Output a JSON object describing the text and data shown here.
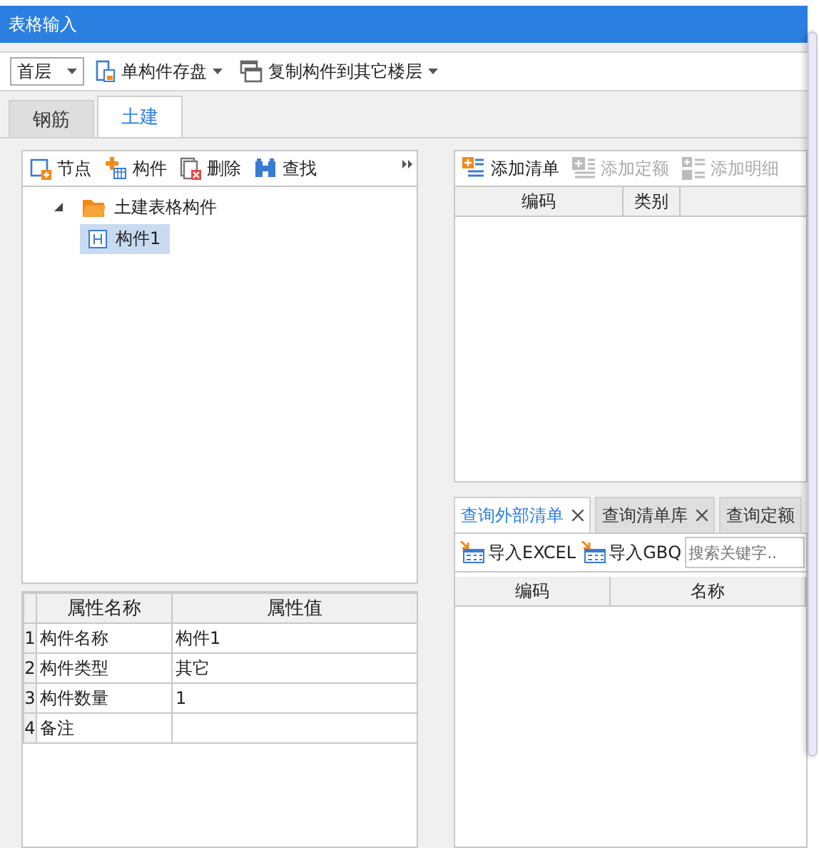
{
  "window": {
    "title": "表格输入"
  },
  "toolbar": {
    "floor_select": {
      "value": "首层"
    },
    "buttons": [
      {
        "label": "单构件存盘"
      },
      {
        "label": "复制构件到其它楼层"
      }
    ]
  },
  "tabs": [
    {
      "label": "钢筋",
      "selected": false
    },
    {
      "label": "土建",
      "selected": true
    }
  ],
  "tree_toolbar": [
    {
      "label": "节点"
    },
    {
      "label": "构件"
    },
    {
      "label": "删除"
    },
    {
      "label": "查找"
    }
  ],
  "tree": [
    {
      "label": "土建表格构件",
      "expanded": true,
      "selected": false,
      "children": [
        {
          "label": "构件1",
          "selected": true
        }
      ]
    }
  ],
  "properties": {
    "columns": [
      "属性名称",
      "属性值"
    ],
    "rows": [
      {
        "index": "1",
        "name": "构件名称",
        "value": "构件1"
      },
      {
        "index": "2",
        "name": "构件类型",
        "value": "其它"
      },
      {
        "index": "3",
        "name": "构件数量",
        "value": "1"
      },
      {
        "index": "4",
        "name": "备注"
      }
    ]
  },
  "list_toolbar": [
    {
      "label": "添加清单",
      "disabled": false
    },
    {
      "label": "添加定额",
      "disabled": true
    },
    {
      "label": "添加明细",
      "disabled": true
    }
  ],
  "list_table": {
    "columns": [
      "编码",
      "类别"
    ]
  },
  "query_tabs": [
    {
      "label": "查询外部清单",
      "selected": true,
      "closable": true
    },
    {
      "label": "查询清单库",
      "selected": false,
      "closable": true
    },
    {
      "label": "查询定额",
      "selected": false,
      "closable": false
    }
  ],
  "query_toolbar": {
    "buttons": [
      {
        "label": "导入EXCEL"
      },
      {
        "label": "导入GBQ"
      }
    ],
    "search": {
      "placeholder": "搜索关键字.."
    }
  },
  "query_table": {
    "columns": [
      "编码",
      "名称"
    ]
  }
}
